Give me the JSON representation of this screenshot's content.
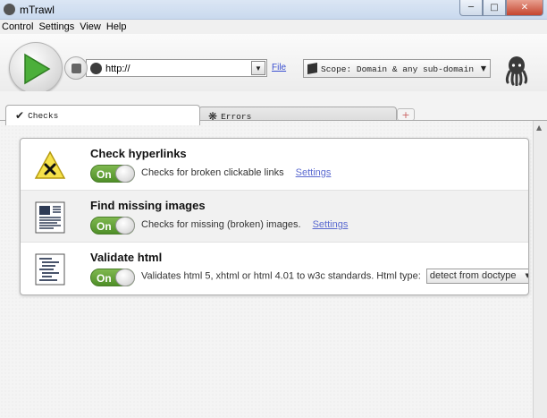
{
  "window": {
    "title": "mTrawl"
  },
  "menu": [
    {
      "label": "Control"
    },
    {
      "label": "Settings"
    },
    {
      "label": "View"
    },
    {
      "label": "Help"
    }
  ],
  "toolbar": {
    "url_value": "http://",
    "file_label": "File",
    "scope_label": "Scope: Domain & any sub-domain"
  },
  "tabs": [
    {
      "label": "Checks",
      "active": true
    },
    {
      "label": "Errors",
      "active": false
    }
  ],
  "checks": [
    {
      "title": "Check hyperlinks",
      "toggle": "On",
      "description": "Checks for broken clickable links",
      "settings_label": "Settings"
    },
    {
      "title": "Find missing images",
      "toggle": "On",
      "description": "Checks for missing (broken) images.",
      "settings_label": "Settings"
    },
    {
      "title": "Validate html",
      "toggle": "On",
      "description": "Validates html 5, xhtml or html 4.01 to w3c standards. Html type:",
      "html_type": "detect from doctype"
    }
  ],
  "colors": {
    "toggle_on": "#5c9b33",
    "link": "#5b6ad0",
    "play": "#4caf3a"
  }
}
